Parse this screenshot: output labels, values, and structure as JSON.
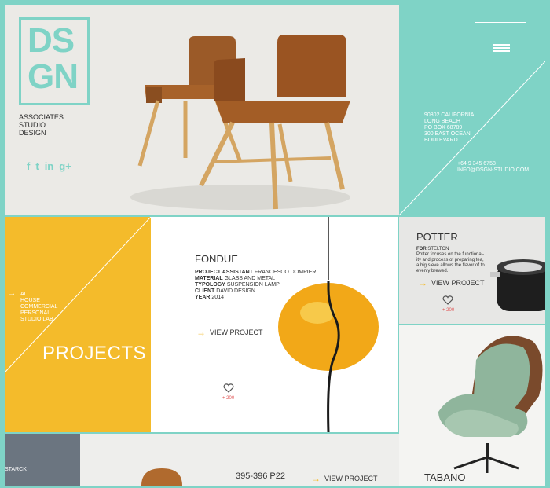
{
  "brand": {
    "logo_lines": [
      "DS",
      "GN"
    ],
    "tagline": [
      "ASSOCIATES",
      "STUDIO",
      "DESIGN"
    ],
    "social": [
      {
        "icon": "facebook-icon",
        "glyph": "f"
      },
      {
        "icon": "twitter-icon",
        "glyph": "t"
      },
      {
        "icon": "linkedin-icon",
        "glyph": "in"
      },
      {
        "icon": "googleplus-icon",
        "glyph": "g+"
      }
    ]
  },
  "contact": {
    "address": [
      "90802 CALIFORNIA",
      "LONG BEACH",
      "PO BOX 68789",
      "300 EAST OCEAN",
      "BOULEVARD"
    ],
    "phone": "+64 9 345 6758",
    "email": "INFO@DSGN-STUDIO.COM"
  },
  "projects_panel": {
    "filters": [
      "ALL",
      "HOUSE",
      "COMMERCIAL",
      "PERSONAL",
      "STUDIO LAB"
    ],
    "title": "PROJECTS"
  },
  "fondue": {
    "title": "FONDUE",
    "details": [
      {
        "label": "PROJECT ASSISTANT",
        "value": "FRANCESCO DOMPIERI"
      },
      {
        "label": "MATERIAL",
        "value": "GLASS AND METAL"
      },
      {
        "label": "TYPOLOGY",
        "value": "SUSPENSION LAMP"
      },
      {
        "label": "CLIENT",
        "value": "DAVID DESIGN"
      },
      {
        "label": "YEAR",
        "value": "2014"
      }
    ],
    "view_label": "VIEW PROJECT",
    "likes": "+ 200"
  },
  "potter": {
    "title": "POTTER",
    "for_label": "FOR",
    "for_value": "STELTON",
    "desc": [
      "Potter focuses on the functional-",
      "ity and process of preparing tea,",
      "a big sieve allows the flavor of to",
      "evenly brewed."
    ],
    "view_label": "VIEW PROJECT",
    "likes": "+ 200"
  },
  "tabano": {
    "title": "TABANO"
  },
  "bottom": {
    "starck_label": "STARCK",
    "project_title": "395-396 P22",
    "view_label": "VIEW PROJECT"
  },
  "colors": {
    "teal": "#7fd3c6",
    "yellow": "#f4bb2b",
    "light": "#ebeae6"
  }
}
